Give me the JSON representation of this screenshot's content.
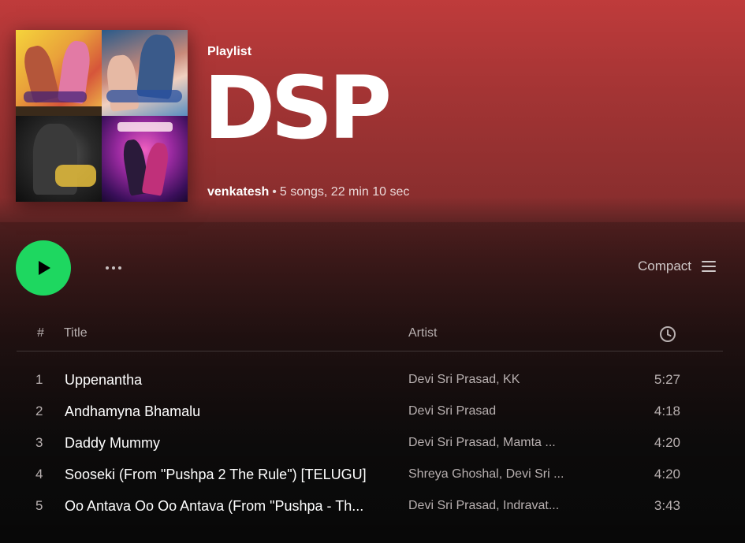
{
  "playlist": {
    "kind_label": "Playlist",
    "title": "DSP",
    "owner": "venkatesh",
    "separator": "•",
    "summary": "5 songs, 22 min 10 sec"
  },
  "actions": {
    "play_icon": "play-icon",
    "more_icon": "more-icon",
    "view_label": "Compact",
    "view_icon": "list-icon"
  },
  "table": {
    "headers": {
      "number": "#",
      "title": "Title",
      "artist": "Artist",
      "duration_icon": "clock-icon"
    },
    "rows": [
      {
        "num": "1",
        "title": "Uppenantha",
        "artist": "Devi Sri Prasad, KK",
        "duration": "5:27"
      },
      {
        "num": "2",
        "title": "Andhamyna Bhamalu",
        "artist": "Devi Sri Prasad",
        "duration": "4:18"
      },
      {
        "num": "3",
        "title": "Daddy Mummy",
        "artist": "Devi Sri Prasad, Mamta ...",
        "duration": "4:20"
      },
      {
        "num": "4",
        "title": "Sooseki (From \"Pushpa 2 The Rule\") [TELUGU]",
        "artist": "Shreya Ghoshal, Devi Sri ...",
        "duration": "4:20"
      },
      {
        "num": "5",
        "title": "Oo Antava Oo Oo Antava (From \"Pushpa - Th...",
        "artist": "Devi Sri Prasad, Indravat...",
        "duration": "3:43"
      }
    ]
  },
  "colors": {
    "accent_green": "#1ed760",
    "header_red": "#bf3b3b",
    "background": "#121212"
  }
}
